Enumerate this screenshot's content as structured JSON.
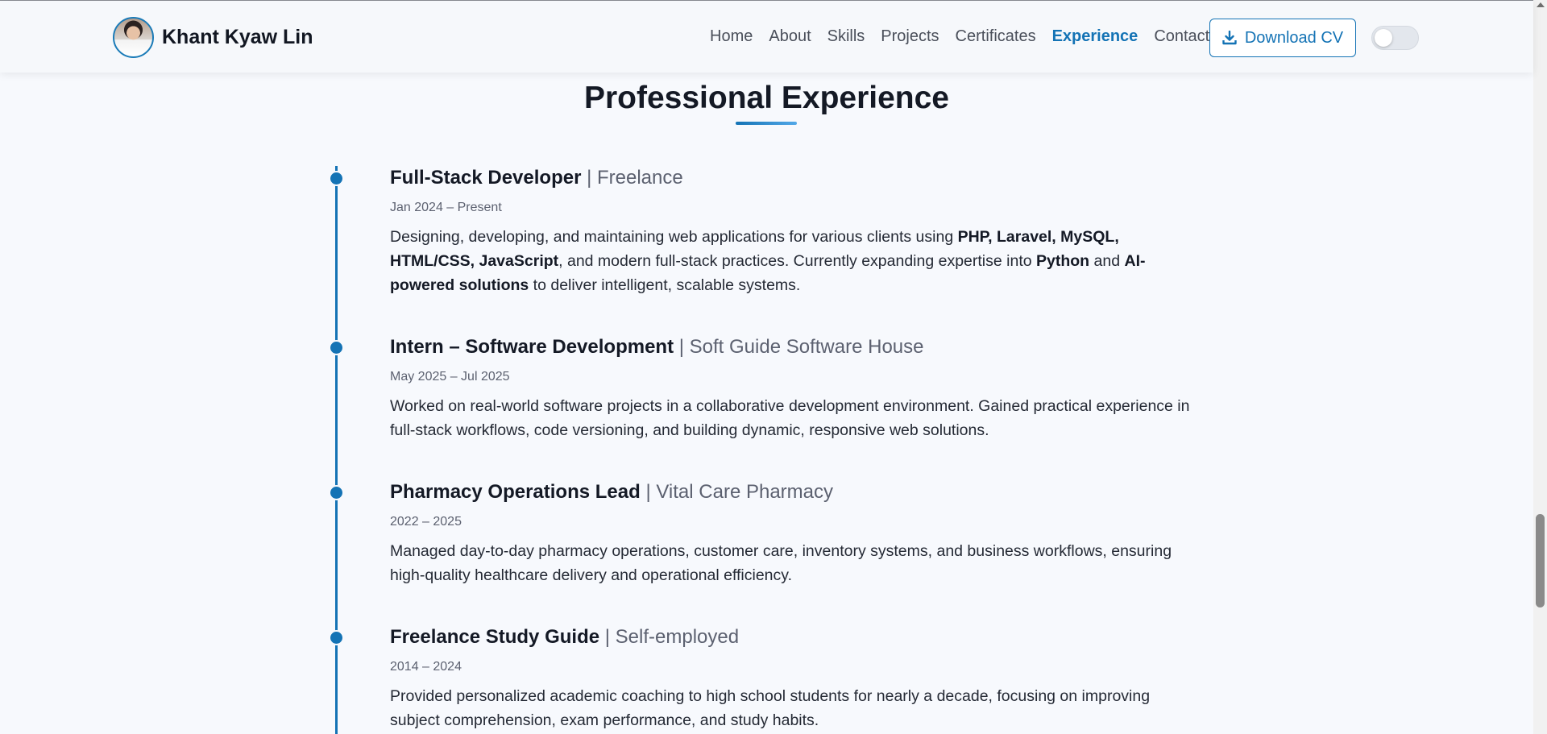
{
  "header": {
    "brand_name": "Khant Kyaw Lin",
    "nav": [
      "Home",
      "About",
      "Skills",
      "Projects",
      "Certificates",
      "Experience",
      "Contact"
    ],
    "active_nav": "Experience",
    "download_label": "Download CV",
    "accent_color": "#1473b5"
  },
  "section": {
    "title": "Professional Experience"
  },
  "experience": [
    {
      "role": "Full-Stack Developer",
      "org": "Freelance",
      "dates": "Jan 2024 – Present",
      "desc_parts": [
        {
          "t": "Designing, developing, and maintaining web applications for various clients using "
        },
        {
          "t": "PHP, Laravel, MySQL, HTML/CSS, JavaScript",
          "b": true
        },
        {
          "t": ", and modern full-stack practices. Currently expanding expertise into "
        },
        {
          "t": "Python",
          "b": true
        },
        {
          "t": " and "
        },
        {
          "t": "AI-powered solutions",
          "b": true
        },
        {
          "t": " to deliver intelligent, scalable systems."
        }
      ]
    },
    {
      "role": "Intern – Software Development",
      "org": "Soft Guide Software House",
      "dates": "May 2025 – Jul 2025",
      "desc_parts": [
        {
          "t": "Worked on real-world software projects in a collaborative development environment. Gained practical experience in full-stack workflows, code versioning, and building dynamic, responsive web solutions."
        }
      ]
    },
    {
      "role": "Pharmacy Operations Lead",
      "org": "Vital Care Pharmacy",
      "dates": "2022 – 2025",
      "desc_parts": [
        {
          "t": "Managed day-to-day pharmacy operations, customer care, inventory systems, and business workflows, ensuring high-quality healthcare delivery and operational efficiency."
        }
      ]
    },
    {
      "role": "Freelance Study Guide",
      "org": "Self-employed",
      "dates": "2014 – 2024",
      "desc_parts": [
        {
          "t": "Provided personalized academic coaching to high school students for nearly a decade, focusing on improving subject comprehension, exam performance, and study habits."
        }
      ]
    }
  ]
}
